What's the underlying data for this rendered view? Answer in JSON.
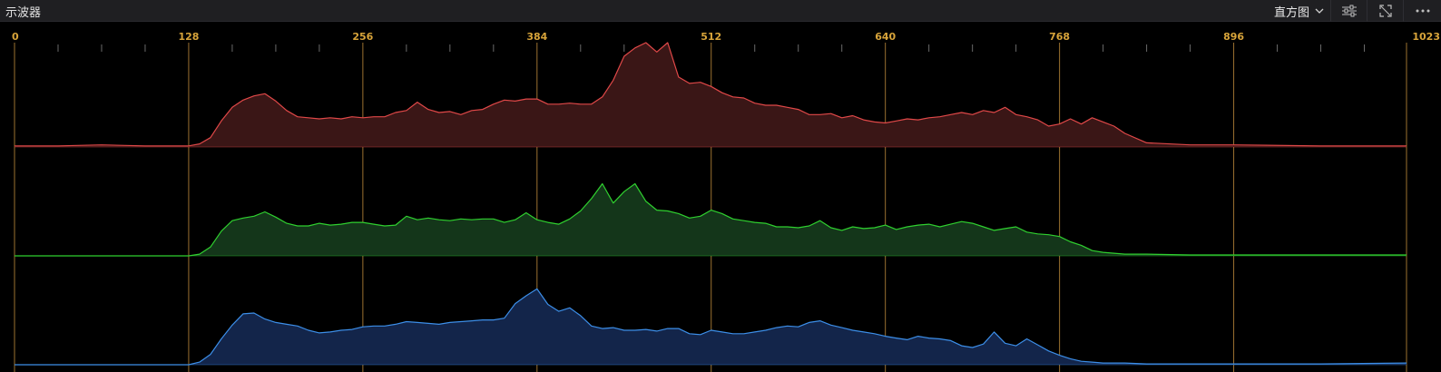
{
  "panel": {
    "title": "示波器",
    "mode_label": "直方图"
  },
  "toolbar": {
    "icons": [
      "chevron-down-icon",
      "sliders-icon",
      "expand-icon",
      "more-icon"
    ]
  },
  "colors": {
    "background": "#000000",
    "titlebar": "#1f1f22",
    "tick_label": "#d8a43a",
    "guide": "#b8863a",
    "red_line": "#e04848",
    "red_fill": "#3a1616",
    "green_line": "#2fd02f",
    "green_fill": "#14361a",
    "blue_line": "#3c8ee8",
    "blue_fill": "#13254a"
  },
  "chart_data": {
    "type": "area",
    "title": "",
    "xlabel": "",
    "ylabel": "",
    "xlim": [
      0,
      1023
    ],
    "ylim": [
      0,
      1
    ],
    "x_ticks": [
      0,
      128,
      256,
      384,
      512,
      640,
      768,
      896,
      1023
    ],
    "x_tick_labels": [
      "0",
      "128",
      "256",
      "384",
      "512",
      "640",
      "768",
      "896",
      "1023"
    ],
    "x": [
      0,
      32,
      64,
      96,
      128,
      136,
      144,
      152,
      160,
      168,
      176,
      184,
      192,
      200,
      208,
      216,
      224,
      232,
      240,
      248,
      256,
      264,
      272,
      280,
      288,
      296,
      304,
      312,
      320,
      328,
      336,
      344,
      352,
      360,
      368,
      376,
      384,
      392,
      400,
      408,
      416,
      424,
      432,
      440,
      448,
      456,
      464,
      472,
      480,
      488,
      496,
      504,
      512,
      520,
      528,
      536,
      544,
      552,
      560,
      568,
      576,
      584,
      592,
      600,
      608,
      616,
      624,
      632,
      640,
      648,
      656,
      664,
      672,
      680,
      688,
      696,
      704,
      712,
      720,
      728,
      736,
      744,
      752,
      760,
      768,
      776,
      784,
      792,
      800,
      808,
      816,
      832,
      864,
      896,
      960,
      1023
    ],
    "series": [
      {
        "channel": "red",
        "values": [
          0.01,
          0.01,
          0.02,
          0.01,
          0.01,
          0.03,
          0.09,
          0.25,
          0.38,
          0.45,
          0.49,
          0.51,
          0.44,
          0.35,
          0.29,
          0.28,
          0.27,
          0.28,
          0.27,
          0.29,
          0.28,
          0.29,
          0.29,
          0.33,
          0.35,
          0.43,
          0.36,
          0.33,
          0.34,
          0.31,
          0.35,
          0.36,
          0.41,
          0.45,
          0.44,
          0.46,
          0.46,
          0.41,
          0.41,
          0.42,
          0.41,
          0.41,
          0.48,
          0.64,
          0.87,
          0.95,
          1.0,
          0.91,
          1.0,
          0.67,
          0.61,
          0.62,
          0.58,
          0.52,
          0.48,
          0.47,
          0.42,
          0.4,
          0.4,
          0.38,
          0.36,
          0.31,
          0.31,
          0.32,
          0.28,
          0.3,
          0.26,
          0.24,
          0.23,
          0.25,
          0.27,
          0.26,
          0.28,
          0.29,
          0.31,
          0.33,
          0.31,
          0.35,
          0.33,
          0.38,
          0.31,
          0.29,
          0.26,
          0.2,
          0.22,
          0.27,
          0.22,
          0.28,
          0.24,
          0.2,
          0.13,
          0.04,
          0.02,
          0.02,
          0.01,
          0.01
        ]
      },
      {
        "channel": "green",
        "values": [
          0.0,
          0.0,
          0.0,
          0.0,
          0.0,
          0.02,
          0.1,
          0.28,
          0.4,
          0.43,
          0.45,
          0.5,
          0.44,
          0.37,
          0.34,
          0.34,
          0.37,
          0.35,
          0.36,
          0.38,
          0.38,
          0.36,
          0.34,
          0.35,
          0.45,
          0.41,
          0.43,
          0.41,
          0.4,
          0.42,
          0.41,
          0.42,
          0.42,
          0.38,
          0.41,
          0.49,
          0.41,
          0.38,
          0.36,
          0.42,
          0.51,
          0.65,
          0.82,
          0.6,
          0.73,
          0.82,
          0.62,
          0.52,
          0.51,
          0.48,
          0.43,
          0.45,
          0.52,
          0.48,
          0.42,
          0.4,
          0.38,
          0.37,
          0.33,
          0.33,
          0.32,
          0.34,
          0.4,
          0.32,
          0.29,
          0.33,
          0.31,
          0.32,
          0.35,
          0.3,
          0.33,
          0.35,
          0.36,
          0.33,
          0.36,
          0.39,
          0.37,
          0.33,
          0.29,
          0.31,
          0.33,
          0.27,
          0.25,
          0.24,
          0.22,
          0.16,
          0.12,
          0.06,
          0.04,
          0.03,
          0.02,
          0.02,
          0.01,
          0.01,
          0.01,
          0.01
        ]
      },
      {
        "channel": "blue",
        "values": [
          0.0,
          0.0,
          0.0,
          0.0,
          0.0,
          0.03,
          0.12,
          0.3,
          0.46,
          0.59,
          0.6,
          0.53,
          0.49,
          0.47,
          0.45,
          0.4,
          0.37,
          0.38,
          0.4,
          0.41,
          0.44,
          0.45,
          0.45,
          0.47,
          0.5,
          0.49,
          0.48,
          0.47,
          0.49,
          0.5,
          0.51,
          0.52,
          0.52,
          0.54,
          0.71,
          0.8,
          0.88,
          0.7,
          0.62,
          0.66,
          0.57,
          0.45,
          0.42,
          0.43,
          0.4,
          0.4,
          0.41,
          0.39,
          0.42,
          0.42,
          0.36,
          0.35,
          0.4,
          0.38,
          0.36,
          0.36,
          0.38,
          0.4,
          0.43,
          0.45,
          0.44,
          0.49,
          0.51,
          0.46,
          0.43,
          0.4,
          0.38,
          0.36,
          0.33,
          0.31,
          0.29,
          0.33,
          0.31,
          0.3,
          0.28,
          0.22,
          0.2,
          0.24,
          0.38,
          0.25,
          0.22,
          0.3,
          0.23,
          0.16,
          0.11,
          0.07,
          0.04,
          0.03,
          0.02,
          0.02,
          0.02,
          0.01,
          0.01,
          0.01,
          0.01,
          0.02
        ]
      }
    ],
    "grid": true,
    "legend": "none"
  }
}
